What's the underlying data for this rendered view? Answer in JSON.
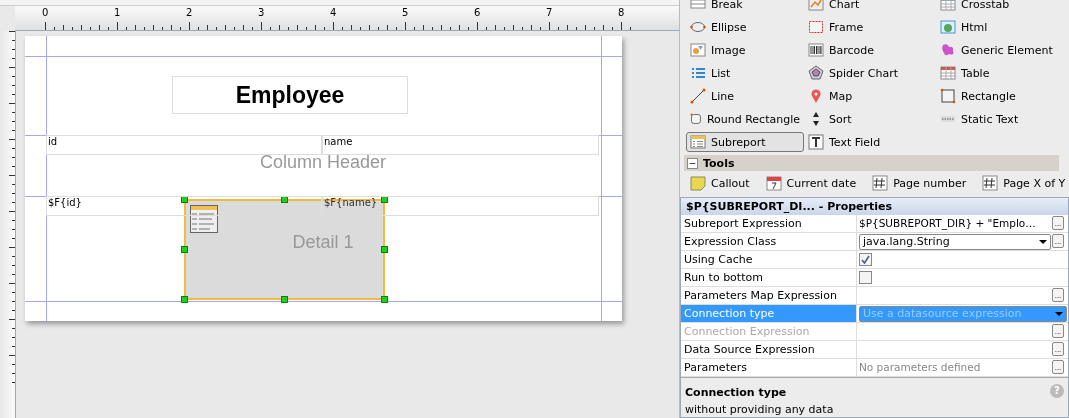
{
  "ruler": {
    "top_marks": [
      "0",
      "1",
      "2",
      "3",
      "4",
      "5",
      "6",
      "7",
      "8"
    ]
  },
  "report": {
    "title": "Employee",
    "bands": [
      {
        "name": "Column Header",
        "fields": [
          "id",
          "name"
        ]
      },
      {
        "name": "Detail 1",
        "fields": [
          "$F{id}",
          "$F{name}"
        ]
      }
    ],
    "subreport": {
      "selected": true
    }
  },
  "palette": {
    "items": [
      {
        "label": "Break",
        "selected": false
      },
      {
        "label": "Chart",
        "selected": false
      },
      {
        "label": "Crosstab",
        "selected": false
      },
      {
        "label": "Ellipse",
        "selected": false
      },
      {
        "label": "Frame",
        "selected": false
      },
      {
        "label": "Html",
        "selected": false
      },
      {
        "label": "Image",
        "selected": false
      },
      {
        "label": "Barcode",
        "selected": false
      },
      {
        "label": "Generic Element",
        "selected": false
      },
      {
        "label": "List",
        "selected": false
      },
      {
        "label": "Spider Chart",
        "selected": false
      },
      {
        "label": "Table",
        "selected": false
      },
      {
        "label": "Line",
        "selected": false
      },
      {
        "label": "Map",
        "selected": false
      },
      {
        "label": "Rectangle",
        "selected": false
      },
      {
        "label": "Round Rectangle",
        "selected": false
      },
      {
        "label": "Sort",
        "selected": false
      },
      {
        "label": "Static Text",
        "selected": false
      },
      {
        "label": "Subreport",
        "selected": true
      },
      {
        "label": "Text Field",
        "selected": false
      }
    ],
    "tools_title": "Tools",
    "collapse": "−",
    "tools": [
      {
        "label": "Callout"
      },
      {
        "label": "Current date"
      },
      {
        "label": "Page number"
      },
      {
        "label": "Page X of Y"
      }
    ]
  },
  "properties": {
    "title": "$P{SUBREPORT_DI... - Properties",
    "rows": [
      {
        "label": "Subreport Expression",
        "kind": "text",
        "value": "$P{SUBREPORT_DIR} + \"Emplo…",
        "selected": false,
        "disabled": false,
        "button": "..."
      },
      {
        "label": "Expression Class",
        "kind": "combo",
        "value": "java.lang.String",
        "selected": false,
        "disabled": false,
        "button": "..."
      },
      {
        "label": "Using Cache",
        "kind": "checkbox",
        "checked": true,
        "selected": false,
        "disabled": false
      },
      {
        "label": "Run to bottom",
        "kind": "checkbox",
        "checked": false,
        "selected": false,
        "disabled": false
      },
      {
        "label": "Parameters Map Expression",
        "kind": "text",
        "value": "",
        "selected": false,
        "disabled": false,
        "button": "..."
      },
      {
        "label": "Connection type",
        "kind": "combo",
        "value": "Use a datasource expression",
        "selected": true,
        "disabled": false
      },
      {
        "label": "Connection Expression",
        "kind": "text",
        "value": "",
        "selected": false,
        "disabled": true,
        "button": "..."
      },
      {
        "label": "Data Source Expression",
        "kind": "text",
        "value": "",
        "selected": false,
        "disabled": false,
        "button": "..."
      },
      {
        "label": "Parameters",
        "kind": "hint",
        "value": "No parameters defined",
        "selected": false,
        "disabled": false,
        "button": "..."
      }
    ],
    "help_title": "Connection type",
    "help_text": "without providing any data",
    "help_icon": "?"
  }
}
